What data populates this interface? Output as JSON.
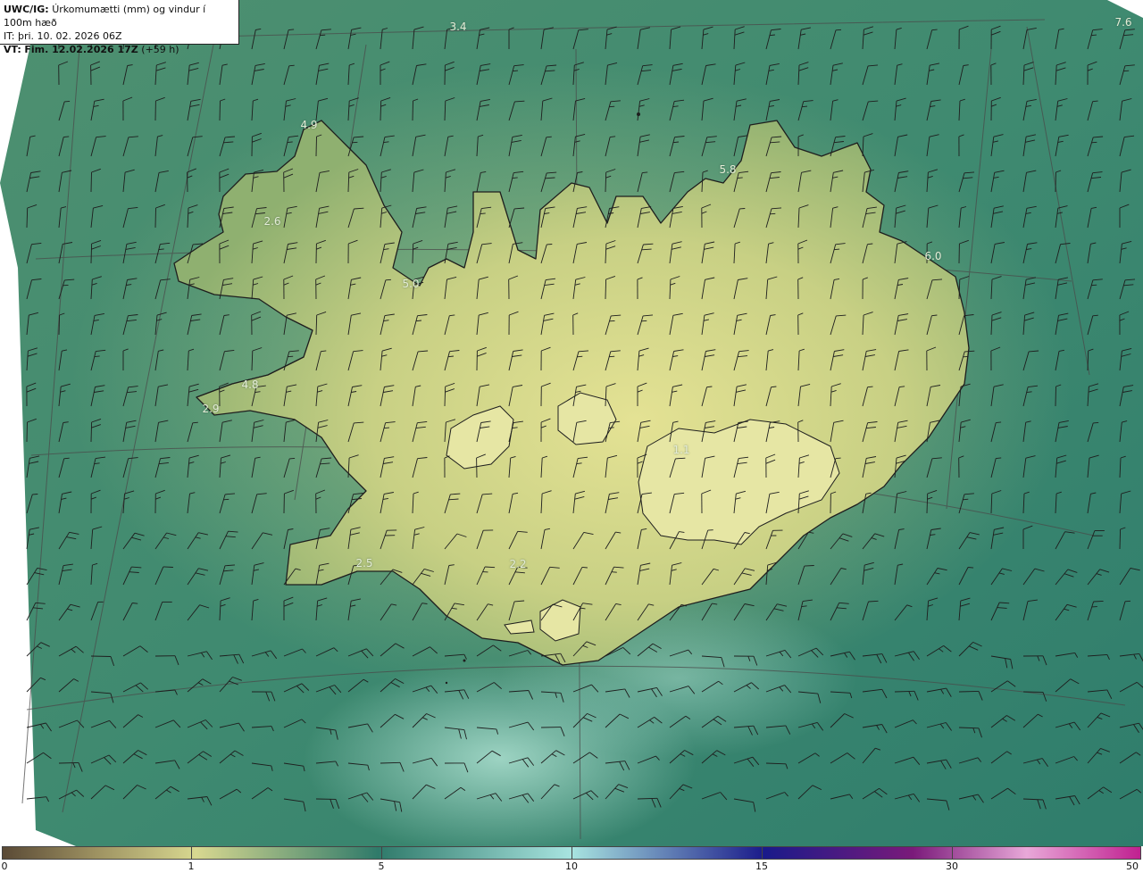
{
  "header": {
    "model": "UWC/IG:",
    "title": "Úrkomumætti (mm) og vindur í 100m hæð",
    "initial_time": "IT: þri. 10. 02. 2026 06Z",
    "valid_prefix": "VT:",
    "valid_time": "Fim. 12.02.2026 17Z",
    "lead": "(+59 h)"
  },
  "value_labels": [
    {
      "text": "3.4"
    },
    {
      "text": "4.9"
    },
    {
      "text": "2.6"
    },
    {
      "text": "5.0"
    },
    {
      "text": "4.8"
    },
    {
      "text": "2.9"
    },
    {
      "text": "5.8"
    },
    {
      "text": "6.0"
    },
    {
      "text": "2.5"
    },
    {
      "text": "2.2"
    },
    {
      "text": "1.1"
    },
    {
      "text": "7.6"
    }
  ],
  "colorbar": {
    "ticks": [
      "0",
      "1",
      "5",
      "10",
      "15",
      "30",
      "50"
    ],
    "colors": [
      "#5a4a36",
      "#9c9060",
      "#d8d890",
      "#2f7a6a",
      "#a8e4e0",
      "#1a1a8a",
      "#7a1a7a",
      "#e8a8d8",
      "#c02090"
    ]
  },
  "map_colors": {
    "sea": "#3f8a70",
    "land_low": "#8fb070",
    "land_high": "#e2e290",
    "coast": "#1e1e1e",
    "barb": "#1e1e1e",
    "grid": "#4a4a4a"
  }
}
